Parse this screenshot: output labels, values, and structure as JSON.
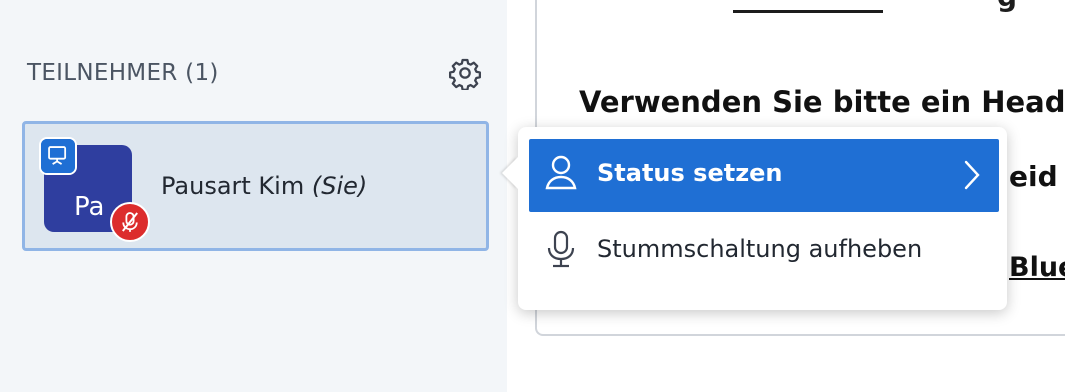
{
  "sidebar": {
    "title": "TEILNEHMER (1)",
    "settings_icon": "gear-icon",
    "participant": {
      "initials": "Pa",
      "name": "Pausart Kim",
      "you_label": "(Sie)",
      "presenter_icon": "presenter-icon",
      "mic_icon": "muted-mic-icon"
    }
  },
  "main": {
    "heading": "Verwenden Sie bitte ein Head",
    "fragment_top": "g",
    "fragment_right": "eid",
    "link_fragment": "Blue"
  },
  "context_menu": {
    "items": [
      {
        "label": "Status setzen",
        "icon": "user-icon",
        "has_submenu": true
      },
      {
        "label": "Stummschaltung aufheben",
        "icon": "microphone-icon",
        "has_submenu": false
      }
    ]
  },
  "colors": {
    "accent": "#1f6fd4",
    "avatar": "#2f3e9f",
    "muted": "#dc2c2c",
    "sidebar_bg": "#f3f6f9",
    "selected_bg": "#dde6ef"
  }
}
